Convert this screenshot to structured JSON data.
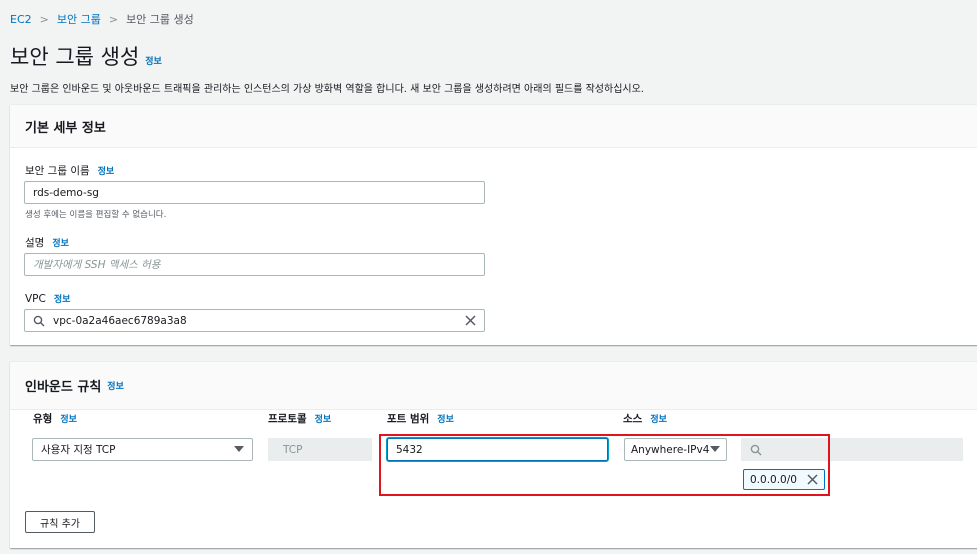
{
  "breadcrumb": {
    "items": [
      "EC2",
      "보안 그룹",
      "보안 그룹 생성"
    ]
  },
  "page": {
    "title": "보안 그룹 생성",
    "info": "정보",
    "description": "보안 그룹은 인바운드 및 아웃바운드 트래픽을 관리하는 인스턴스의 가상 방화벽 역할을 합니다. 새 보안 그룹을 생성하려면 아래의 필드를 작성하십시오."
  },
  "basic": {
    "header": "기본 세부 정보",
    "name_label": "보안 그룹 이름",
    "name_value": "rds-demo-sg",
    "name_hint": "생성 후에는 이름을 편집할 수 없습니다.",
    "desc_label": "설명",
    "desc_placeholder": "개발자에게 SSH 액세스 허용",
    "vpc_label": "VPC",
    "vpc_value": "vpc-0a2a46aec6789a3a8",
    "info": "정보"
  },
  "inbound": {
    "header": "인바운드 규칙",
    "info": "정보",
    "columns": {
      "type": "유형",
      "protocol": "프로토콜",
      "port": "포트 범위",
      "source": "소스"
    },
    "rule": {
      "type": "사용자 지정 TCP",
      "protocol": "TCP",
      "port": "5432",
      "source": "Anywhere-IPv4",
      "cidr_token": "0.0.0.0/0"
    },
    "add_rule_label": "규칙 추가"
  },
  "colors": {
    "link": "#0073bb",
    "highlight": "#e0141c"
  }
}
